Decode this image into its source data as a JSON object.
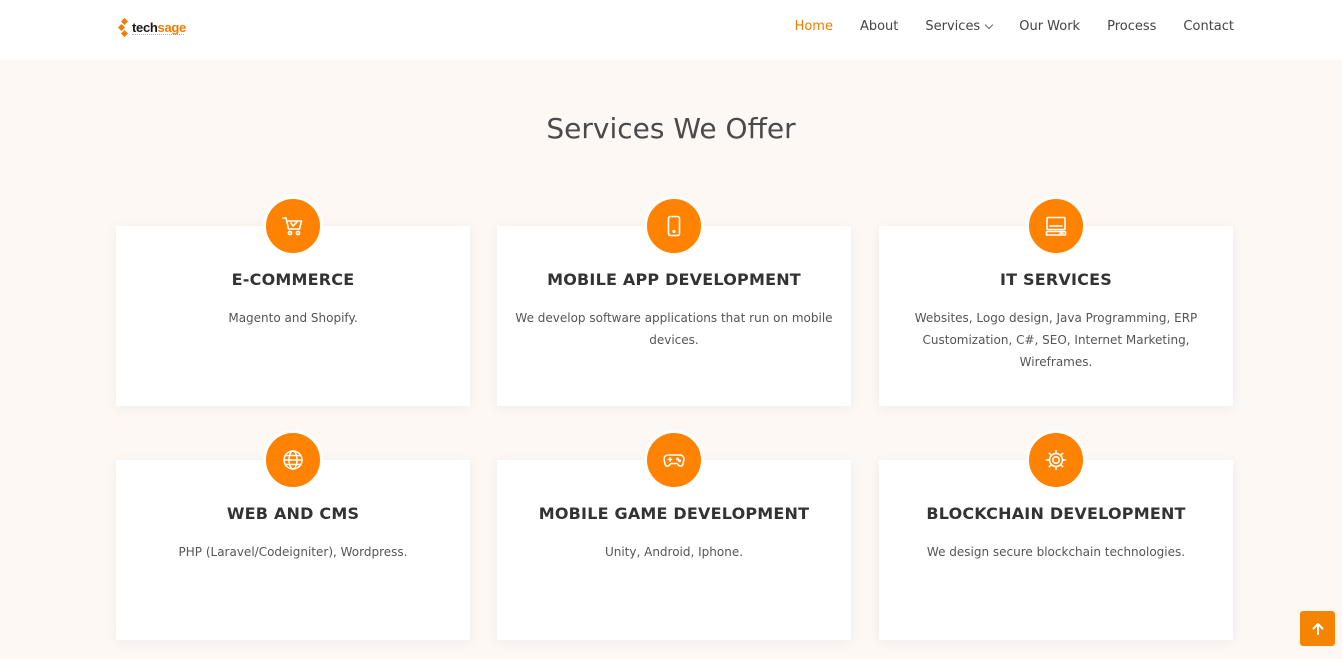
{
  "brand": {
    "name_prefix": "tech",
    "name_suffix": "sage",
    "accent_color": "#ff8200"
  },
  "nav": {
    "items": [
      {
        "label": "Home",
        "active": true
      },
      {
        "label": "About"
      },
      {
        "label": "Services",
        "has_dropdown": true
      },
      {
        "label": "Our Work"
      },
      {
        "label": "Process"
      },
      {
        "label": "Contact"
      }
    ]
  },
  "services": {
    "title": "Services We Offer",
    "cards": [
      {
        "title": "E-COMMERCE",
        "description": "Magento and Shopify.",
        "icon": "shopping-cart-icon"
      },
      {
        "title": "MOBILE APP DEVELOPMENT",
        "description": "We develop software applications that run on mobile devices.",
        "icon": "mobile-phone-icon"
      },
      {
        "title": "IT SERVICES",
        "description": "Websites, Logo design, Java Programming, ERP Customization, C#, SEO, Internet Marketing, Wireframes.",
        "icon": "desktop-icon"
      },
      {
        "title": "WEB AND CMS",
        "description": "PHP (Laravel/Codeigniter), Wordpress.",
        "icon": "globe-icon"
      },
      {
        "title": "MOBILE GAME DEVELOPMENT",
        "description": "Unity, Android, Iphone.",
        "icon": "gamepad-icon"
      },
      {
        "title": "BLOCKCHAIN DEVELOPMENT",
        "description": "We design secure blockchain technologies.",
        "icon": "gear-icon"
      }
    ]
  },
  "scroll_top": {
    "icon": "arrow-up-icon"
  }
}
